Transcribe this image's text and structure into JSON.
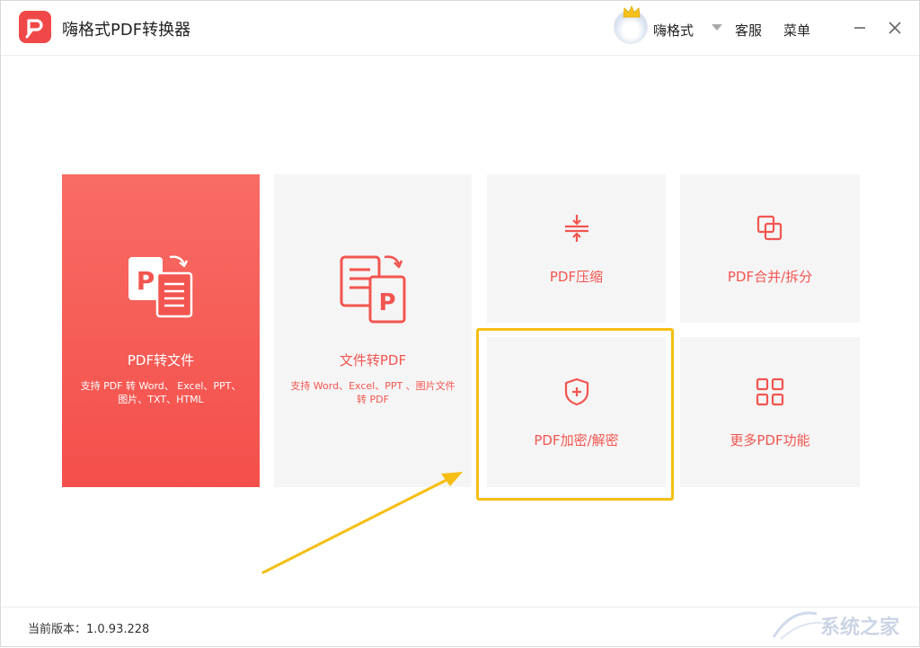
{
  "app": {
    "title": "嗨格式PDF转换器"
  },
  "header": {
    "user_name": "嗨格式",
    "service_label": "客服",
    "menu_label": "菜单"
  },
  "cards": {
    "pdf_to_file": {
      "title": "PDF转文件",
      "desc": "支持 PDF 转 Word、 Excel、PPT、图片、TXT、HTML"
    },
    "file_to_pdf": {
      "title": "文件转PDF",
      "desc": "支持 Word、Excel、PPT 、图片文件转 PDF"
    },
    "compress": {
      "title": "PDF压缩"
    },
    "merge_split": {
      "title": "PDF合并/拆分"
    },
    "encrypt": {
      "title": "PDF加密/解密"
    },
    "more": {
      "title": "更多PDF功能"
    }
  },
  "footer": {
    "version": "当前版本：1.0.93.228"
  },
  "watermark": {
    "text": "系统之家"
  },
  "colors": {
    "accent": "#f04848",
    "highlight": "#f6be12",
    "card_bg": "#f5f5f5"
  },
  "icons": [
    "app-logo-icon",
    "crown-icon",
    "pdf-to-file-icon",
    "file-to-pdf-icon",
    "compress-icon",
    "merge-icon",
    "shield-icon",
    "grid-icon",
    "minimize-icon",
    "close-icon"
  ]
}
